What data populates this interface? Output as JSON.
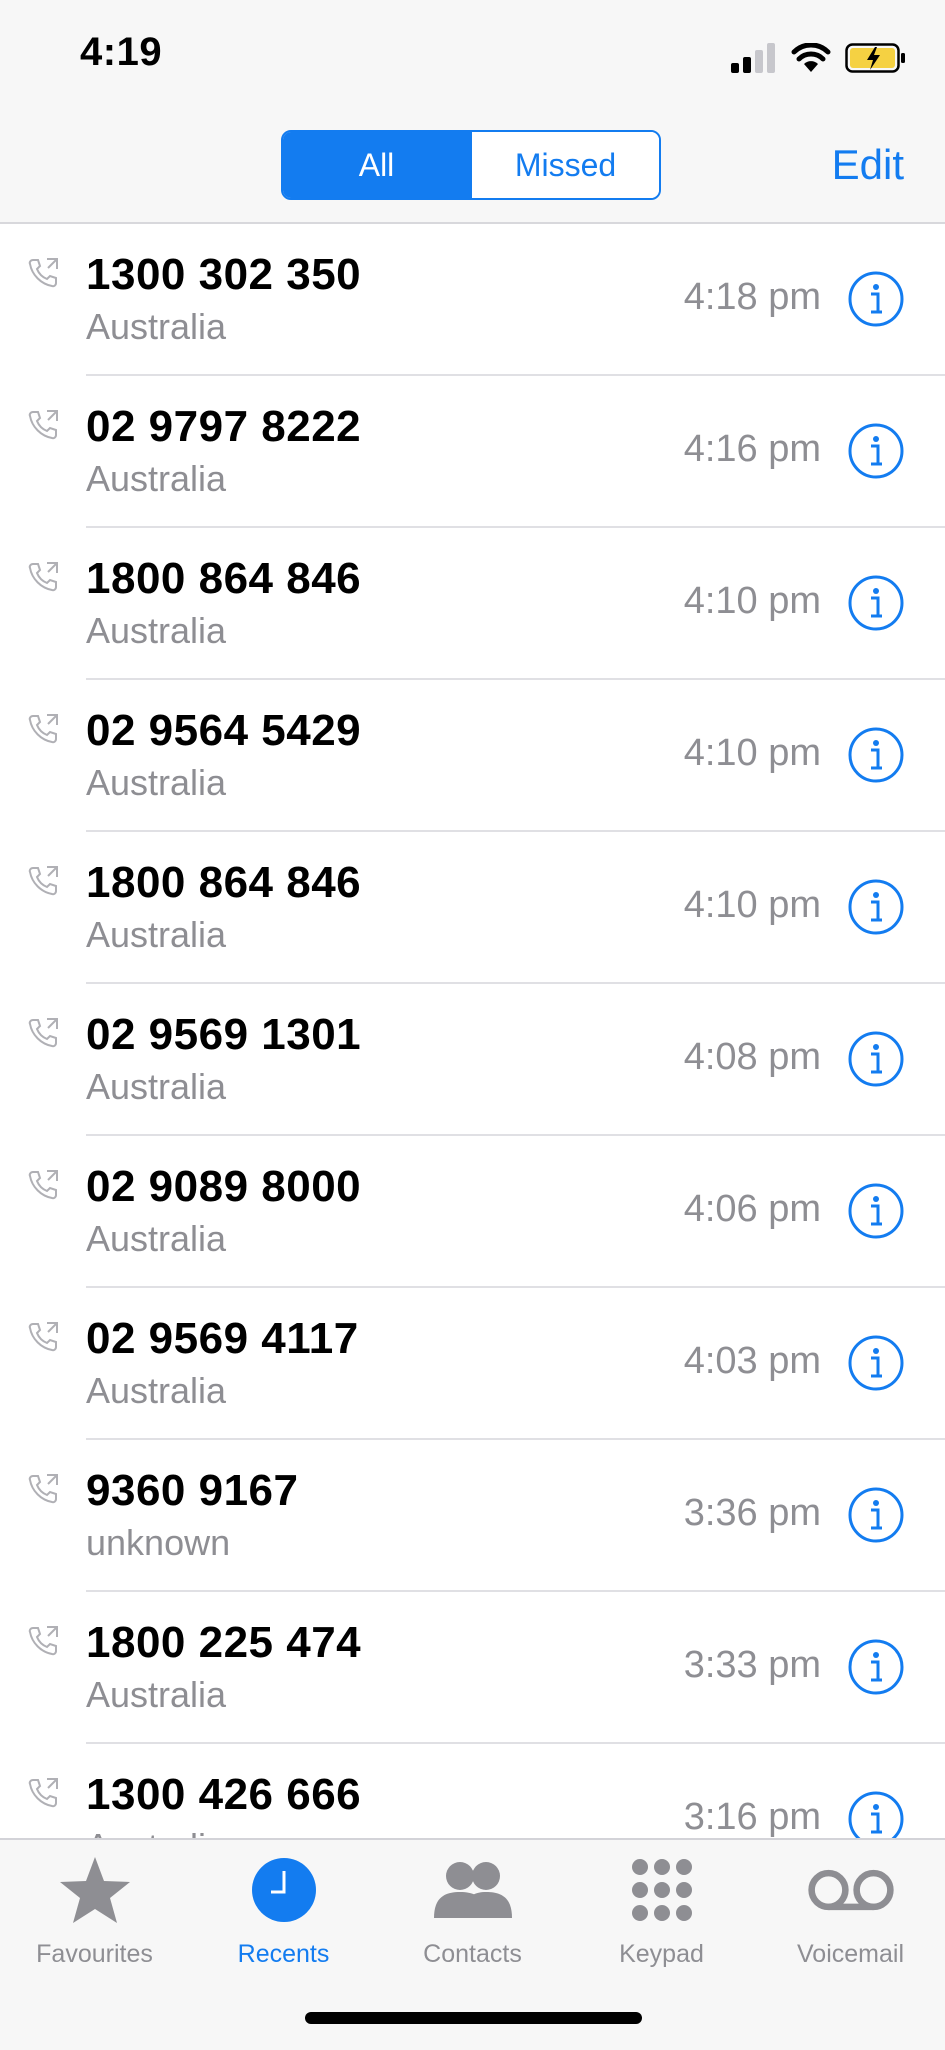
{
  "status": {
    "time": "4:19"
  },
  "nav": {
    "segments": [
      "All",
      "Missed"
    ],
    "active_segment": "All",
    "edit_label": "Edit"
  },
  "calls": [
    {
      "number": "1300 302 350",
      "region": "Australia",
      "time": "4:18 pm"
    },
    {
      "number": "02 9797 8222",
      "region": "Australia",
      "time": "4:16 pm"
    },
    {
      "number": "1800 864 846",
      "region": "Australia",
      "time": "4:10 pm"
    },
    {
      "number": "02 9564 5429",
      "region": "Australia",
      "time": "4:10 pm"
    },
    {
      "number": "1800 864 846",
      "region": "Australia",
      "time": "4:10 pm"
    },
    {
      "number": "02 9569 1301",
      "region": "Australia",
      "time": "4:08 pm"
    },
    {
      "number": "02 9089 8000",
      "region": "Australia",
      "time": "4:06 pm"
    },
    {
      "number": "02 9569 4117",
      "region": "Australia",
      "time": "4:03 pm"
    },
    {
      "number": "9360 9167",
      "region": "unknown",
      "time": "3:36 pm"
    },
    {
      "number": "1800 225 474",
      "region": "Australia",
      "time": "3:33 pm"
    },
    {
      "number": "1300 426 666",
      "region": "Australia",
      "time": "3:16 pm"
    }
  ],
  "tabs": [
    {
      "label": "Favourites",
      "icon": "star-icon",
      "active": false
    },
    {
      "label": "Recents",
      "icon": "clock-icon",
      "active": true
    },
    {
      "label": "Contacts",
      "icon": "contacts-icon",
      "active": false
    },
    {
      "label": "Keypad",
      "icon": "keypad-icon",
      "active": false
    },
    {
      "label": "Voicemail",
      "icon": "voicemail-icon",
      "active": false
    }
  ],
  "colors": {
    "accent": "#137cf0",
    "secondary_text": "#8e8e93",
    "battery": "#f5d142"
  }
}
